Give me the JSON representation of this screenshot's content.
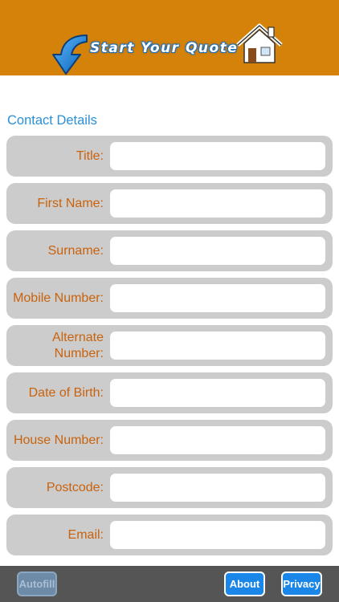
{
  "header": {
    "title": "Start Your Quote",
    "brand_color": "#d4820a",
    "icons": [
      "arrow-icon",
      "house-icon"
    ]
  },
  "section": {
    "title": "Contact Details"
  },
  "form": {
    "fields": [
      {
        "label": "Title:",
        "value": ""
      },
      {
        "label": "First Name:",
        "value": ""
      },
      {
        "label": "Surname:",
        "value": ""
      },
      {
        "label": "Mobile Number:",
        "value": ""
      },
      {
        "label": "Alternate Number:",
        "value": ""
      },
      {
        "label": "Date of Birth:",
        "value": ""
      },
      {
        "label": "House Number:",
        "value": ""
      },
      {
        "label": "Postcode:",
        "value": ""
      },
      {
        "label": "Email:",
        "value": ""
      }
    ],
    "label_color": "#c9620c"
  },
  "toolbar": {
    "autofill_label": "Autofill",
    "about_label": "About",
    "privacy_label": "Privacy",
    "button_color": "#1a86e8"
  }
}
